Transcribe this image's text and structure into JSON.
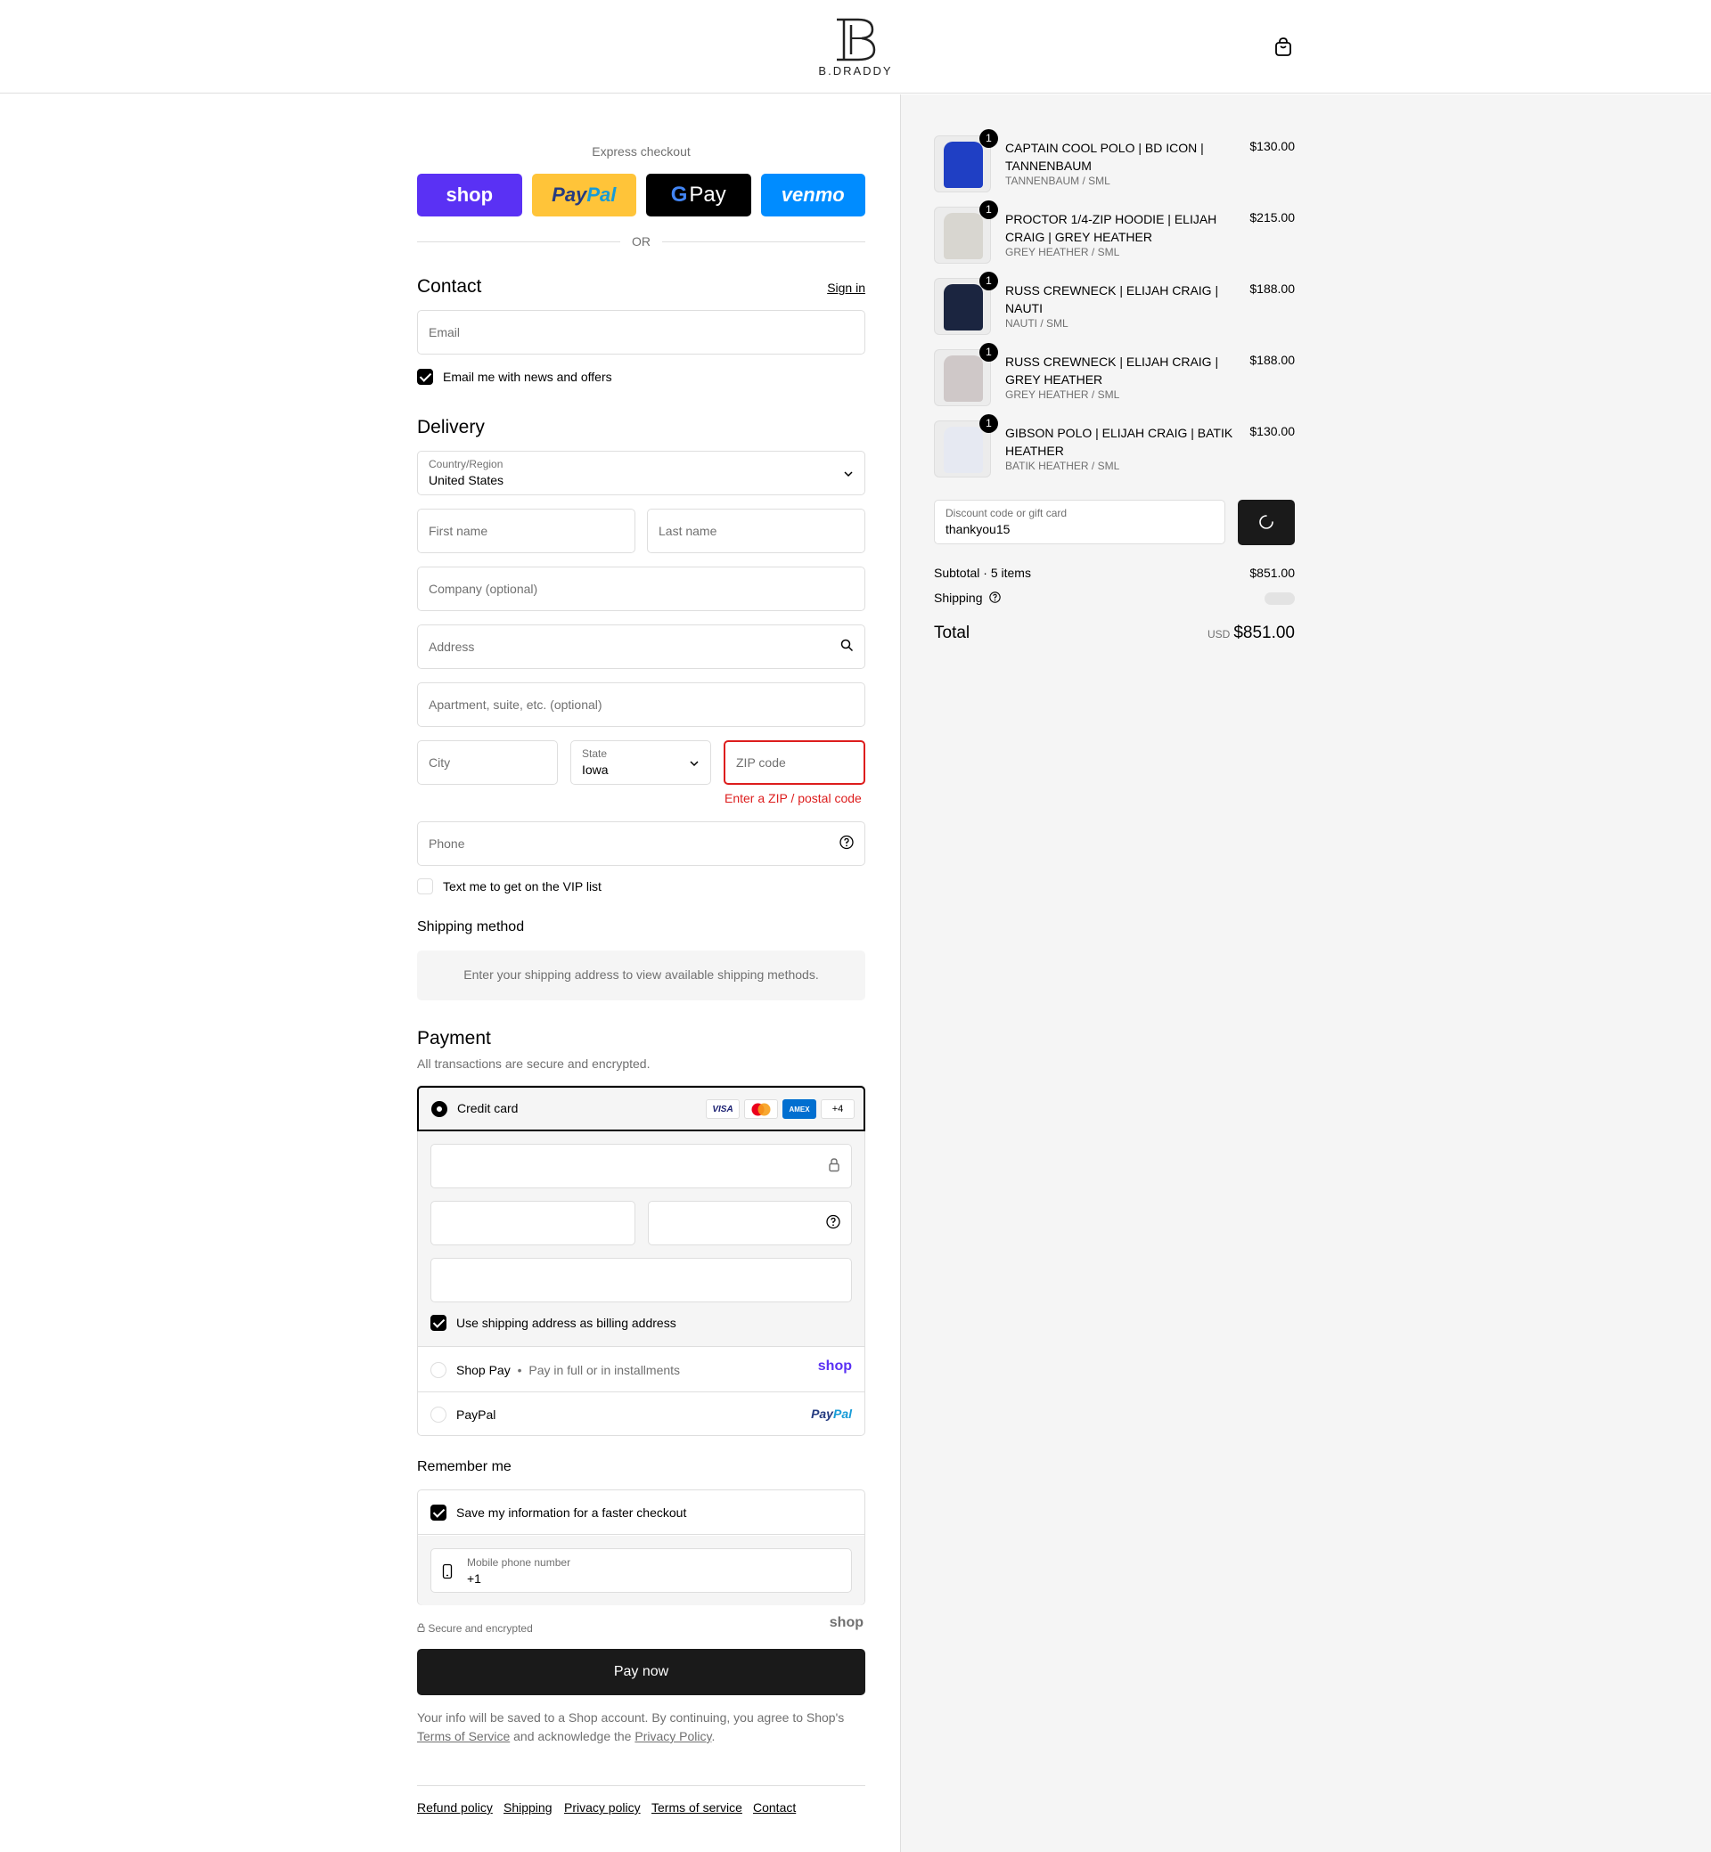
{
  "header": {
    "brand": "B.DRADDY",
    "cart_icon": "shopping-bag-icon"
  },
  "express": {
    "label": "Express checkout",
    "buttons": {
      "shop": "shop",
      "paypal_a": "Pay",
      "paypal_b": "Pal",
      "gpay_g": "G",
      "gpay": "Pay",
      "venmo": "venmo"
    },
    "or": "OR"
  },
  "contact": {
    "title": "Contact",
    "sign_in": "Sign in",
    "email_placeholder": "Email",
    "newsletter_label": "Email me with news and offers",
    "newsletter_checked": true
  },
  "delivery": {
    "title": "Delivery",
    "country_label": "Country/Region",
    "country_value": "United States",
    "first_name": "First name",
    "last_name": "Last name",
    "company": "Company (optional)",
    "address": "Address",
    "apartment": "Apartment, suite, etc. (optional)",
    "city": "City",
    "state_label": "State",
    "state_value": "Iowa",
    "zip": "ZIP code",
    "zip_error": "Enter a ZIP / postal code",
    "phone": "Phone",
    "vip_label": "Text me to get on the VIP list"
  },
  "shipping_method": {
    "title": "Shipping method",
    "message": "Enter your shipping address to view available shipping methods."
  },
  "payment": {
    "title": "Payment",
    "subtitle": "All transactions are secure and encrypted.",
    "credit_card": "Credit card",
    "card_logos": [
      "VISA",
      "AMEX",
      "+4"
    ],
    "billing_label": "Use shipping address as billing address",
    "shop_pay": "Shop Pay",
    "shop_pay_sub": "Pay in full or in installments",
    "shop_pay_logo": "shop",
    "paypal": "PayPal",
    "paypal_logo_a": "Pay",
    "paypal_logo_b": "Pal"
  },
  "remember": {
    "title": "Remember me",
    "save_label": "Save my information for a faster checkout",
    "mobile_label": "Mobile phone number",
    "mobile_value": "+1",
    "secure": "Secure and encrypted",
    "shop_logo": "shop"
  },
  "pay_now": "Pay now",
  "legal": {
    "line1": "Your info will be saved to a Shop account. By continuing, you agree to Shop's",
    "terms": "Terms of Service",
    "mid": "and acknowledge the",
    "privacy": "Privacy Policy",
    "end": "."
  },
  "footer": [
    "Refund policy",
    "Shipping",
    "Privacy policy",
    "Terms of service",
    "Contact"
  ],
  "order": {
    "items": [
      {
        "name": "CAPTAIN COOL POLO | BD ICON | TANNENBAUM",
        "variant": "TANNENBAUM / SML",
        "price": "$130.00",
        "qty": "1",
        "color": "#1f3fc4"
      },
      {
        "name": "PROCTOR 1/4-ZIP HOODIE | ELIJAH CRAIG | GREY HEATHER",
        "variant": "GREY HEATHER / SML",
        "price": "$215.00",
        "qty": "1",
        "color": "#d8d6d0"
      },
      {
        "name": "RUSS CREWNECK | ELIJAH CRAIG | NAUTI",
        "variant": "NAUTI / SML",
        "price": "$188.00",
        "qty": "1",
        "color": "#1b2540"
      },
      {
        "name": "RUSS CREWNECK | ELIJAH CRAIG | GREY HEATHER",
        "variant": "GREY HEATHER / SML",
        "price": "$188.00",
        "qty": "1",
        "color": "#cfc8c8"
      },
      {
        "name": "GIBSON POLO | ELIJAH CRAIG | BATIK HEATHER",
        "variant": "BATIK HEATHER / SML",
        "price": "$130.00",
        "qty": "1",
        "color": "#e6e9f2"
      }
    ],
    "discount_label": "Discount code or gift card",
    "discount_value": "thankyou15",
    "subtotal_label": "Subtotal · 5 items",
    "subtotal_value": "$851.00",
    "shipping_label": "Shipping",
    "total_label": "Total",
    "currency": "USD",
    "total_value": "$851.00"
  }
}
